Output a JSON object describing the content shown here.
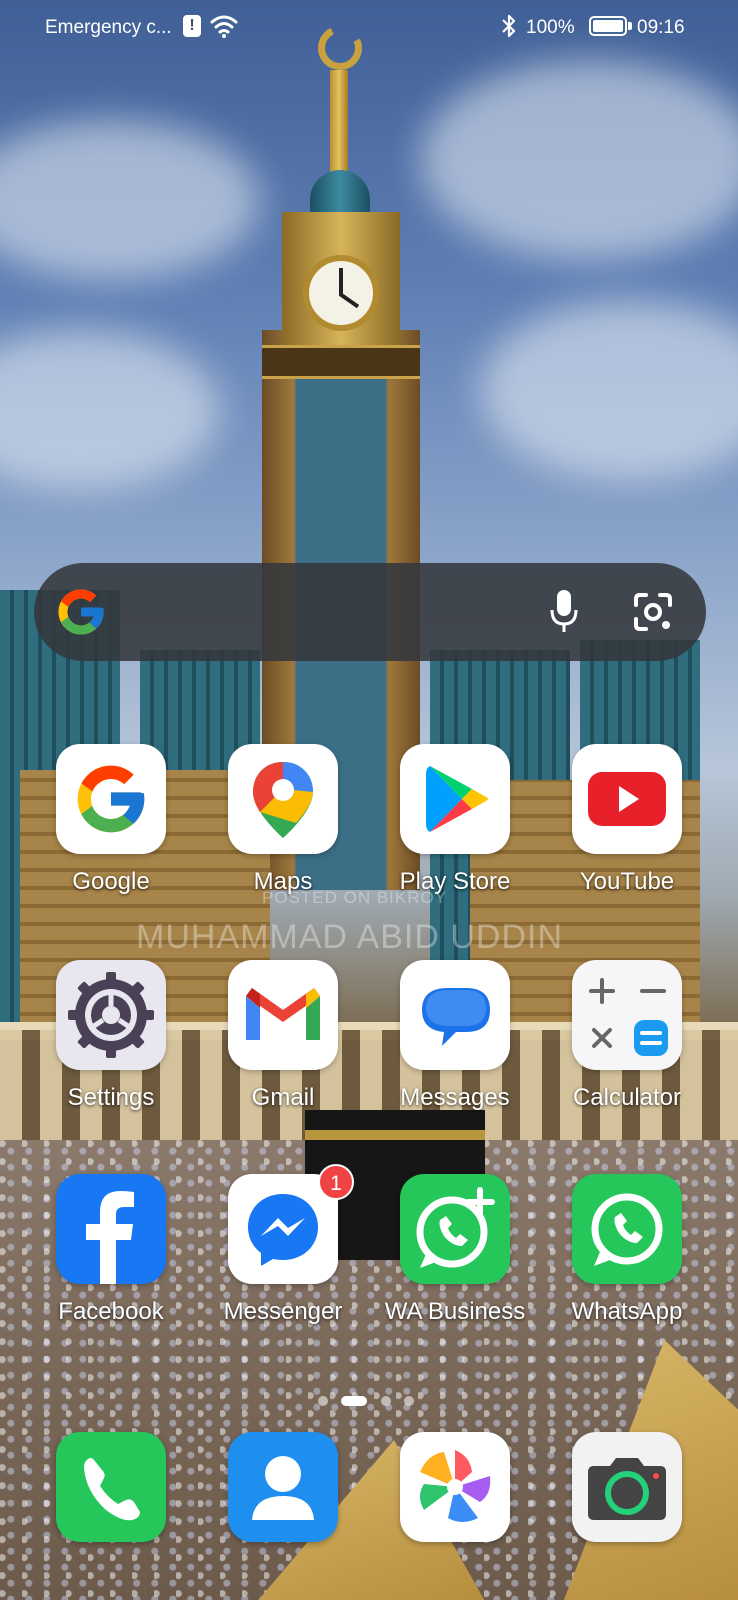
{
  "status_bar": {
    "carrier": "Emergency c...",
    "battery": "100%",
    "time": "09:16"
  },
  "search": {
    "icons": [
      "google-g-icon",
      "mic-icon",
      "lens-icon"
    ]
  },
  "apps": {
    "google": "Google",
    "maps": "Maps",
    "play_store": "Play Store",
    "youtube": "YouTube",
    "settings": "Settings",
    "gmail": "Gmail",
    "messages": "Messages",
    "calculator": "Calculator",
    "facebook": "Facebook",
    "messenger": "Messenger",
    "wa_business": "WA Business",
    "whatsapp": "WhatsApp"
  },
  "messenger_badge": "1",
  "watermark": {
    "line1": "POSTED ON BIKROY",
    "line2": "MUHAMMAD ABID UDDIN"
  },
  "dock": [
    "phone-icon",
    "contacts-icon",
    "gallery-icon",
    "camera-icon"
  ],
  "page_indicator": {
    "pages": 4,
    "current": 2
  },
  "colors": {
    "search_bg": "#34383c",
    "badge": "#f04343",
    "youtube_red": "#e8202a",
    "facebook_blue": "#1877f2",
    "whatsapp_green": "#25c65a"
  }
}
